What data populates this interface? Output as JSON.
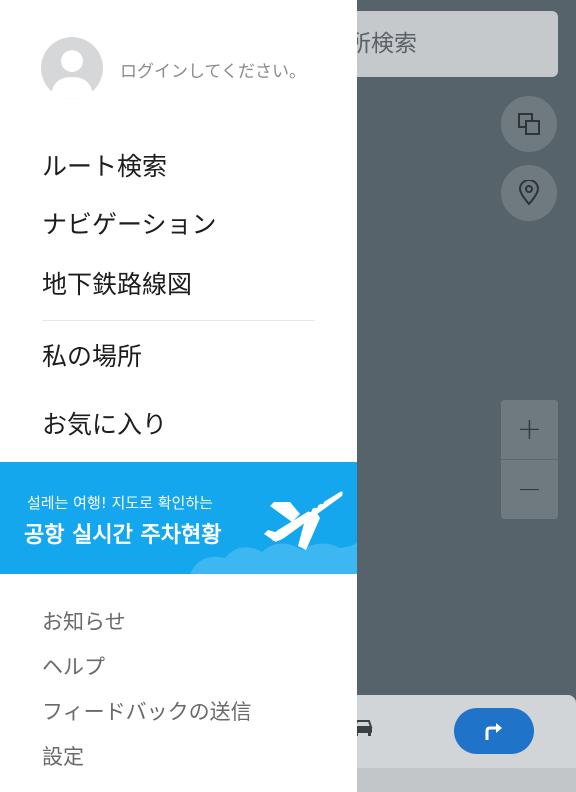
{
  "map": {
    "search_text": "所検索",
    "layers_icon": "layers-icon",
    "pin_icon": "location-pin-icon",
    "zoom_in_label": "+",
    "zoom_out_label": "−",
    "car_icon": "car-icon",
    "route_icon": "turn-right-arrow-icon"
  },
  "drawer": {
    "login_prompt": "ログインしてください。",
    "main_menu": [
      {
        "label": "ルート検索"
      },
      {
        "label": "ナビゲーション"
      },
      {
        "label": "地下鉄路線図"
      },
      {
        "label": "私の場所"
      },
      {
        "label": "お気に入り"
      }
    ],
    "banner": {
      "line1": "설레는 여행! 지도로 확인하는",
      "line2": "공항 실시간 주차현황",
      "icon": "airplane-icon"
    },
    "sub_menu": [
      {
        "label": "お知らせ"
      },
      {
        "label": "ヘルプ"
      },
      {
        "label": "フィードバックの送信"
      },
      {
        "label": "設定"
      }
    ]
  },
  "colors": {
    "banner_bg": "#14a7ee",
    "overlay_bg": "#56636b",
    "route_button": "#1f73c9"
  }
}
